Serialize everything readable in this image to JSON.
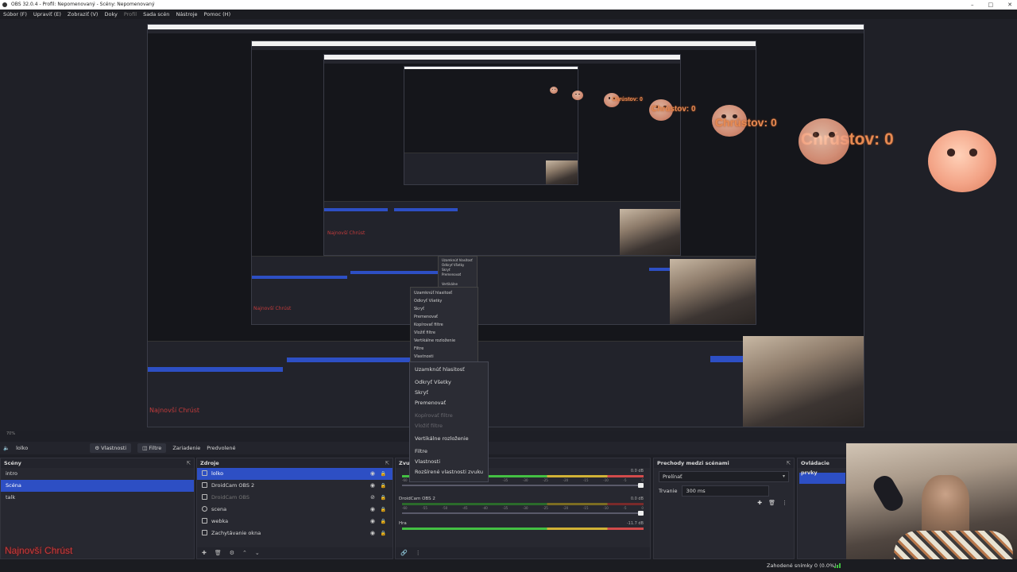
{
  "window": {
    "title": "OBS 32.0.4 - Profil: Nepomenovaný - Scény: Nepomenovaný"
  },
  "menu": {
    "items": [
      "Súbor (F)",
      "Upraviť (E)",
      "Zobraziť (V)",
      "Doky",
      "Profil",
      "Sada scén",
      "Nástroje",
      "Pomoc (H)"
    ]
  },
  "overlay": {
    "counter": "Chrústov: 0",
    "name_text": "Najnovší Chrúst"
  },
  "preview_status": {
    "zoom": "70%",
    "mode": "Vlastnosti"
  },
  "toolbar": {
    "current_source": "lolko",
    "properties_label": "Vlastnosti",
    "filters_label": "Filtre",
    "device_label": "Zariadenie",
    "present_label": "Predvolené"
  },
  "scenes": {
    "title": "Scény",
    "items": [
      "intro",
      "Scéna",
      "talk"
    ],
    "selected": "Scéna"
  },
  "sources": {
    "title": "Zdroje",
    "items": [
      "lolko",
      "DroidCam OBS 2",
      "DroidCam OBS",
      "scena",
      "webka",
      "Zachytávanie okna"
    ]
  },
  "mixer": {
    "title": "Zvuk",
    "channels": [
      {
        "name": "",
        "db": "0.0 dB"
      },
      {
        "name": "DroidCam OBS 2",
        "db": "0.0 dB"
      },
      {
        "name": "Hra",
        "db": "-11.7 dB"
      }
    ],
    "scale": [
      "-60",
      "-55",
      "-50",
      "-45",
      "-40",
      "-35",
      "-30",
      "-25",
      "-20",
      "-15",
      "-10",
      "-5",
      "0"
    ]
  },
  "transitions": {
    "title": "Prechody medzi scénami",
    "type": "Prelínať",
    "duration_label": "Trvanie",
    "duration_value": "300 ms"
  },
  "controls": {
    "title": "Ovládacie prvky"
  },
  "context_menu": {
    "items": [
      {
        "label": "Uzamknúť hlasitosť",
        "disabled": false
      },
      {
        "label": "Odkryť Všetky",
        "disabled": false
      },
      {
        "label": "Skryť",
        "disabled": false
      },
      {
        "label": "Premenovať",
        "disabled": false
      },
      {
        "label": "Kopírovať filtre",
        "disabled": true
      },
      {
        "label": "Vložiť filtre",
        "disabled": true
      },
      {
        "label": "Vertikálne rozloženie",
        "disabled": false
      },
      {
        "label": "Filtre",
        "disabled": false
      },
      {
        "label": "Vlastnosti",
        "disabled": false
      },
      {
        "label": "Rozšírené vlastnosti zvuku",
        "disabled": false
      }
    ]
  },
  "status": {
    "dropped": "Zahodené snímky 0 (0.0%)"
  }
}
